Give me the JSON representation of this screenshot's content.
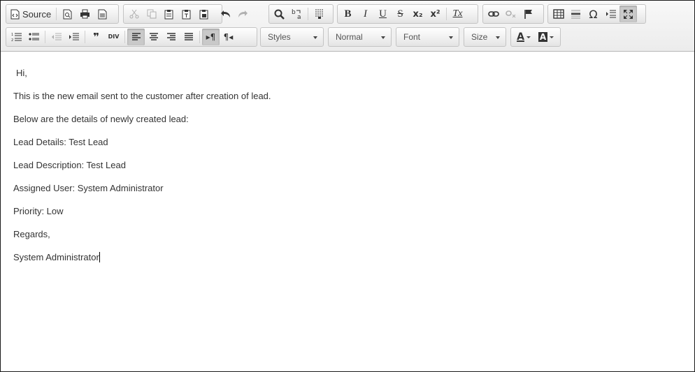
{
  "toolbar": {
    "source_label": "Source",
    "combos": {
      "styles": "Styles",
      "format": "Normal",
      "font": "Font",
      "size": "Size"
    }
  },
  "content": {
    "lines": [
      "Hi,",
      "This is the new email sent to the customer after creation of lead.",
      "Below are the details of newly created lead:",
      "Lead Details: Test Lead",
      "Lead Description: Test Lead",
      "Assigned User: System Administrator",
      "Priority: Low",
      "Regards,",
      "System Administrator"
    ]
  },
  "icons": {
    "bold": "B",
    "italic": "I",
    "underline": "U",
    "strike": "S",
    "subscript": "x₂",
    "superscript": "x²",
    "remove_format": "Tx",
    "special_char": "Ω",
    "text_color": "A",
    "bg_color": "A",
    "blockquote": "❞",
    "div_label": "DIV",
    "ltr": "▸¶",
    "rtl": "¶◂"
  },
  "colors": {
    "toolbar_bg": "#ececec",
    "active_button": "#c9c9c9",
    "text": "#333333"
  }
}
